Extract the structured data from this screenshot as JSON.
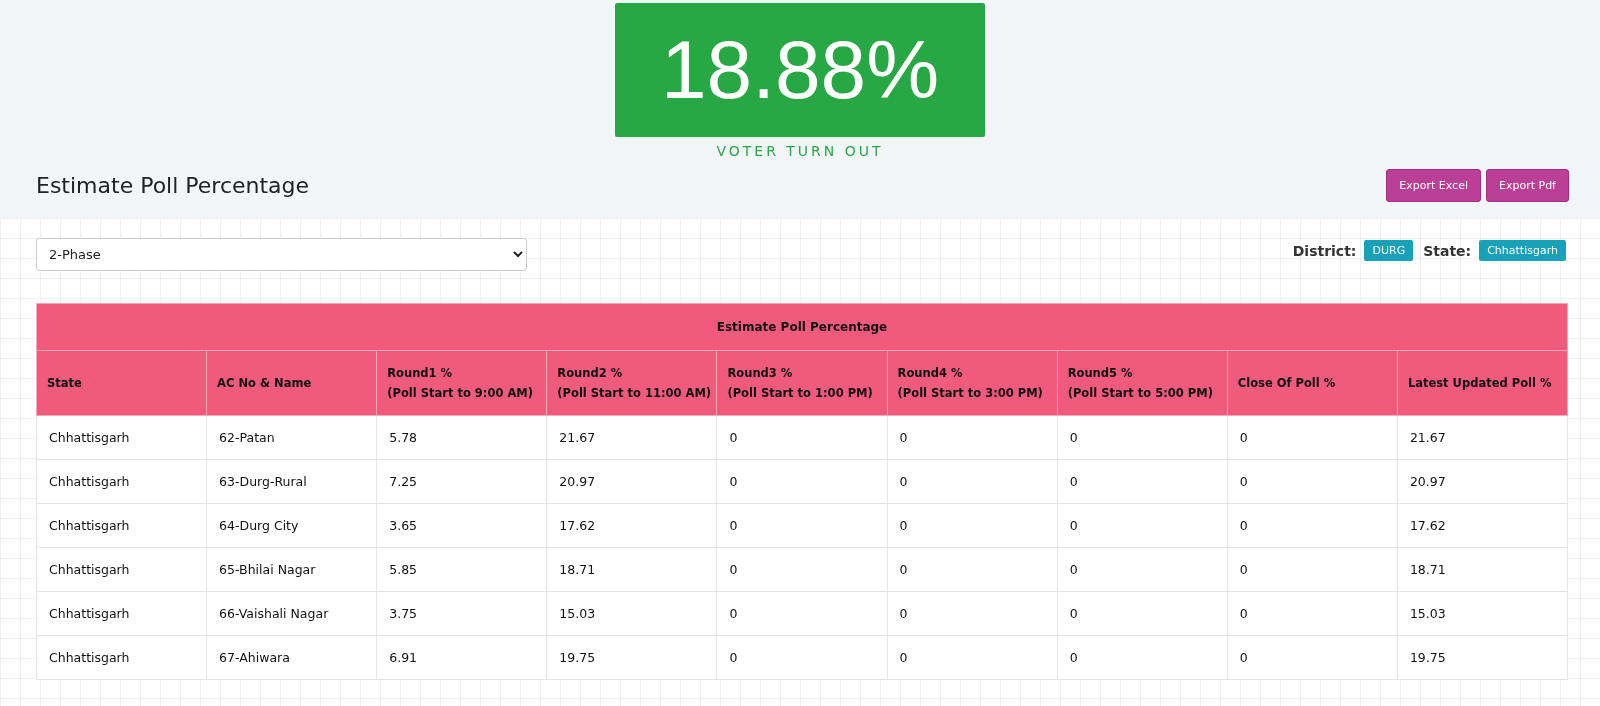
{
  "turnout": {
    "value": "18.88%",
    "label": "VOTER TURN OUT"
  },
  "section": {
    "title": "Estimate Poll Percentage",
    "buttons": [
      "Export Excel",
      "Export Pdf"
    ]
  },
  "filter": {
    "value": "2-Phase"
  },
  "info": [
    {
      "label": "District:",
      "value": "DURG"
    },
    {
      "label": "State:",
      "value": "Chhattisgarh"
    }
  ],
  "table": {
    "title": "Estimate Poll Percentage",
    "columns": [
      {
        "title": "State"
      },
      {
        "title": "AC No & Name"
      },
      {
        "title": "Round1 %",
        "subtitle": "(Poll Start to 9:00 AM)"
      },
      {
        "title": "Round2 %",
        "subtitle": "(Poll Start to 11:00 AM)"
      },
      {
        "title": "Round3 %",
        "subtitle": "(Poll Start to 1:00 PM)"
      },
      {
        "title": "Round4 %",
        "subtitle": "(Poll Start to 3:00 PM)"
      },
      {
        "title": "Round5 %",
        "subtitle": "(Poll Start to 5:00 PM)"
      },
      {
        "title": "Close Of Poll %"
      },
      {
        "title": "Latest Updated Poll %"
      }
    ],
    "rows": [
      [
        "Chhattisgarh",
        "62-Patan",
        "5.78",
        "21.67",
        "0",
        "0",
        "0",
        "0",
        "21.67"
      ],
      [
        "Chhattisgarh",
        "63-Durg-Rural",
        "7.25",
        "20.97",
        "0",
        "0",
        "0",
        "0",
        "20.97"
      ],
      [
        "Chhattisgarh",
        "64-Durg City",
        "3.65",
        "17.62",
        "0",
        "0",
        "0",
        "0",
        "17.62"
      ],
      [
        "Chhattisgarh",
        "65-Bhilai Nagar",
        "5.85",
        "18.71",
        "0",
        "0",
        "0",
        "0",
        "18.71"
      ],
      [
        "Chhattisgarh",
        "66-Vaishali Nagar",
        "3.75",
        "15.03",
        "0",
        "0",
        "0",
        "0",
        "15.03"
      ],
      [
        "Chhattisgarh",
        "67-Ahiwara",
        "6.91",
        "19.75",
        "0",
        "0",
        "0",
        "0",
        "19.75"
      ]
    ]
  }
}
